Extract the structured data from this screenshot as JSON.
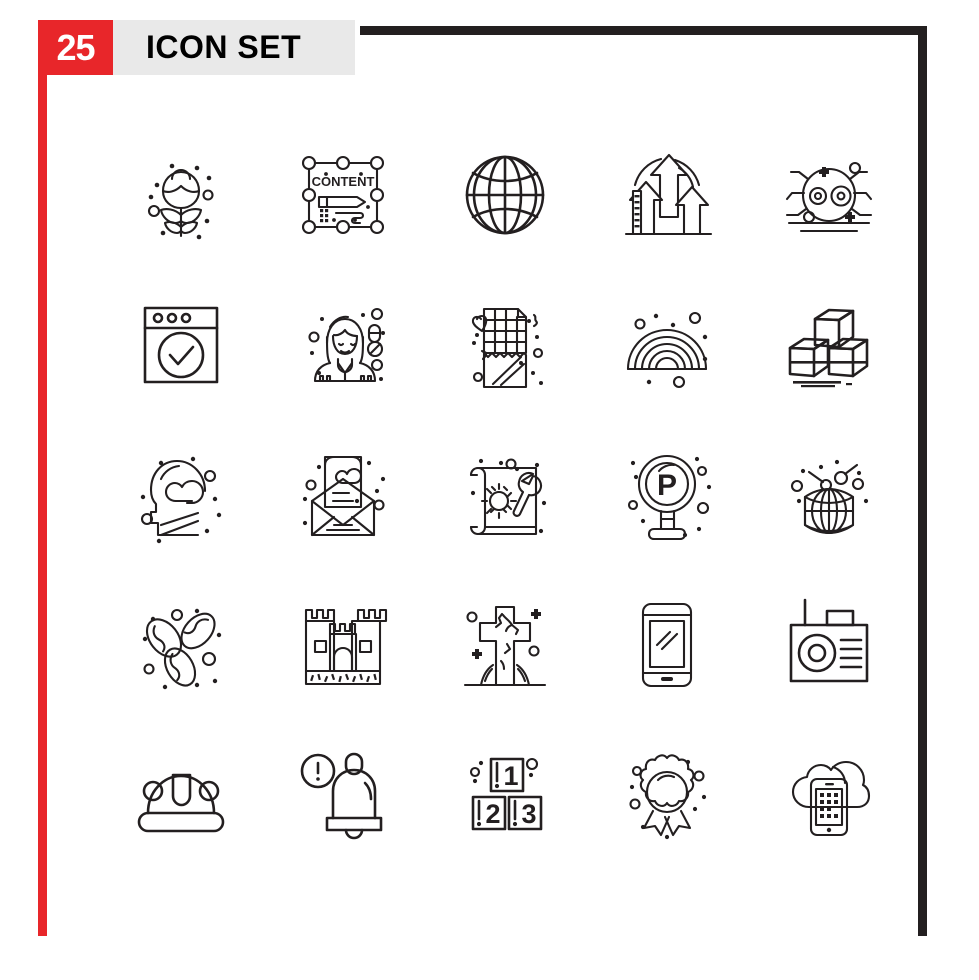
{
  "header": {
    "count_badge": "25",
    "title": "ICON SET",
    "badge_bg": "#e8262a",
    "badge_text_color": "#ffffff",
    "title_strip_bg": "#e9e9e9",
    "title_text_color": "#000000"
  },
  "frame": {
    "accent_color": "#e8262a",
    "border_color": "#231f20"
  },
  "grid": {
    "columns": 5,
    "rows": 5,
    "icon_count": 25,
    "stroke_color": "#231f20",
    "style": "outline"
  },
  "icons": [
    {
      "index": 1,
      "name": "rose-flower-icon",
      "label": "Rose"
    },
    {
      "index": 2,
      "name": "content-editing-icon",
      "label": "Content",
      "inner_text": "CONTENT"
    },
    {
      "index": 3,
      "name": "globe-grid-icon",
      "label": "Globe"
    },
    {
      "index": 4,
      "name": "growth-arrows-icon",
      "label": "Growth"
    },
    {
      "index": 5,
      "name": "spider-bug-icon",
      "label": "Spider"
    },
    {
      "index": 6,
      "name": "browser-check-icon",
      "label": "Browser Verified"
    },
    {
      "index": 7,
      "name": "female-pharmacist-icon",
      "label": "Pharmacist"
    },
    {
      "index": 8,
      "name": "chocolate-bar-icon",
      "label": "Chocolate"
    },
    {
      "index": 9,
      "name": "rainbow-icon",
      "label": "Rainbow"
    },
    {
      "index": 10,
      "name": "stacked-cubes-icon",
      "label": "Boxes"
    },
    {
      "index": 11,
      "name": "love-mind-head-icon",
      "label": "Love Mind"
    },
    {
      "index": 12,
      "name": "love-letter-icon",
      "label": "Love Letter"
    },
    {
      "index": 13,
      "name": "blueprint-settings-icon",
      "label": "Blueprint"
    },
    {
      "index": 14,
      "name": "parking-sign-icon",
      "label": "Parking",
      "inner_text": "P"
    },
    {
      "index": 15,
      "name": "disco-ball-icon",
      "label": "Disco Ball"
    },
    {
      "index": 16,
      "name": "coffee-beans-icon",
      "label": "Coffee Beans"
    },
    {
      "index": 17,
      "name": "sand-castle-icon",
      "label": "Castle"
    },
    {
      "index": 18,
      "name": "grave-cross-icon",
      "label": "Grave"
    },
    {
      "index": 19,
      "name": "smartphone-icon",
      "label": "Mobile"
    },
    {
      "index": 20,
      "name": "radio-icon",
      "label": "Radio"
    },
    {
      "index": 21,
      "name": "winter-hat-icon",
      "label": "Hat"
    },
    {
      "index": 22,
      "name": "alert-bell-icon",
      "label": "Alert Bell"
    },
    {
      "index": 23,
      "name": "numbered-blocks-icon",
      "label": "Ranking",
      "inner_text": "1 2 3"
    },
    {
      "index": 24,
      "name": "award-ribbon-icon",
      "label": "Award"
    },
    {
      "index": 25,
      "name": "cloud-mobile-icon",
      "label": "Cloud Mobile"
    }
  ]
}
